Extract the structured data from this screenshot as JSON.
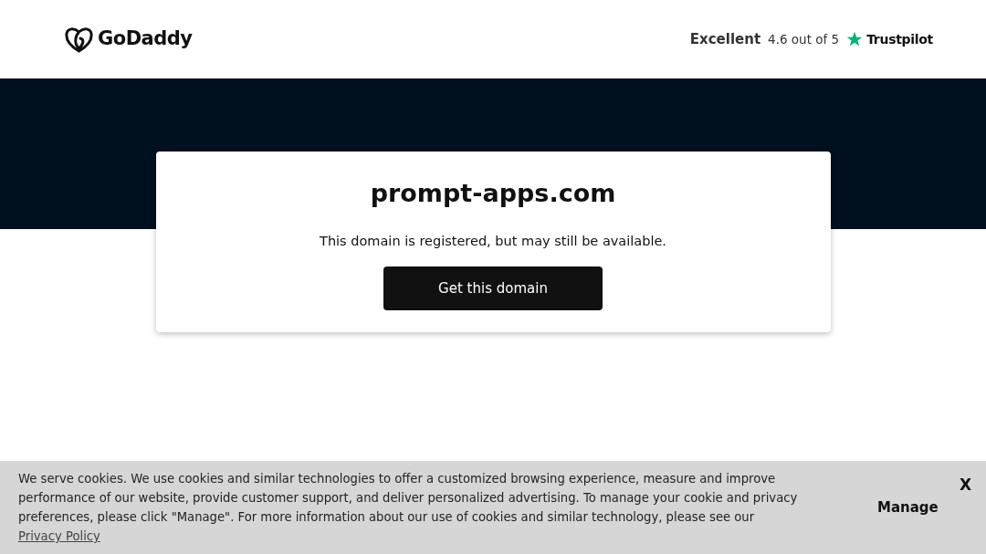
{
  "header": {
    "logo": "GoDaddy",
    "rating_label": "Excellent",
    "rating_text": "4.6 out of 5",
    "rating_brand": "Trustpilot"
  },
  "card": {
    "domain": "prompt-apps.com",
    "message": "This domain is registered, but may still be available.",
    "button": "Get this domain"
  },
  "cookie_banner": {
    "text": "We serve cookies. We use cookies and similar technologies to offer a customized browsing experience, measure and improve performance of our website, provide customer support, and deliver personalized advertising. To manage your cookie and privacy preferences, please click \"Manage\". For more information about our use of cookies and similar technology, please see our ",
    "link": "Privacy Policy",
    "manage": "Manage",
    "close": "X"
  }
}
